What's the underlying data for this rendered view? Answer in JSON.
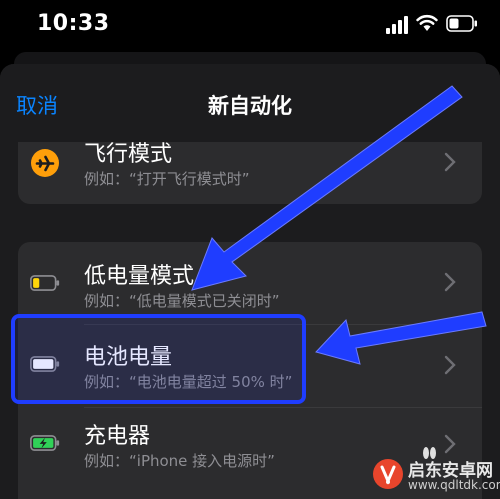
{
  "status": {
    "time": "10:33"
  },
  "nav": {
    "cancel": "取消",
    "title": "新自动化"
  },
  "rows": [
    {
      "label": "飞行模式",
      "sub": "例如：“打开飞行模式时”",
      "icon": "airplane-icon"
    },
    {
      "label": "低电量模式",
      "sub": "例如：“低电量模式已关闭时”",
      "icon": "low-battery-icon"
    },
    {
      "label": "电池电量",
      "sub": "例如：“电池电量超过 50% 时”",
      "icon": "battery-icon"
    },
    {
      "label": "充电器",
      "sub": "例如：“iPhone 接入电源时”",
      "icon": "charging-battery-icon"
    }
  ],
  "watermark": {
    "name": "启东安卓网",
    "url": "www.qdltdk.com"
  },
  "colors": {
    "accent": "#0a84ff",
    "highlight": "#1f3dff",
    "airplane": "#ff9f0a",
    "charging": "#30d158",
    "low": "#ffd60a"
  }
}
